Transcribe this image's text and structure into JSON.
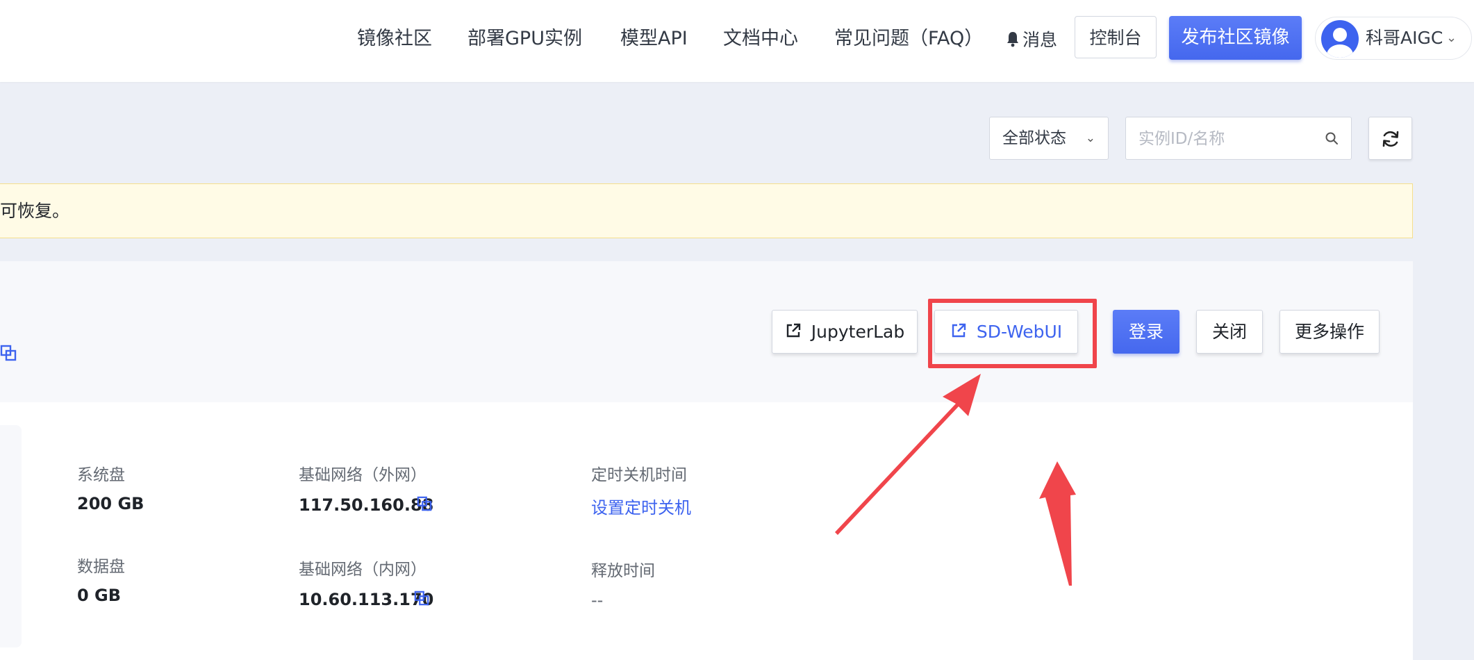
{
  "nav": {
    "links": [
      "镜像社区",
      "部署GPU实例",
      "模型API",
      "文档中心",
      "常见问题（FAQ）"
    ],
    "messages_label": "消息",
    "console_label": "控制台",
    "publish_label": "发布社区镜像",
    "user_name": "科哥AIGC"
  },
  "toolbar": {
    "status_select": "全部状态",
    "search_placeholder": "实例ID/名称"
  },
  "notice": {
    "text": "可恢复。"
  },
  "instance": {
    "actions": {
      "jupyterlab": "JupyterLab",
      "sd_webui": "SD-WebUI",
      "login": "登录",
      "close": "关闭",
      "more": "更多操作"
    },
    "details": {
      "system_disk_label": "系统盘",
      "system_disk_value": "200 GB",
      "data_disk_label": "数据盘",
      "data_disk_value": "0 GB",
      "public_net_label": "基础网络（外网）",
      "public_ip": "117.50.160.88",
      "private_net_label": "基础网络（内网）",
      "private_ip": "10.60.113.170",
      "scheduled_shutdown_label": "定时关机时间",
      "scheduled_shutdown_link": "设置定时关机",
      "release_time_label": "释放时间",
      "release_time_value": "--"
    }
  },
  "colors": {
    "primary": "#4568ee",
    "link": "#3d63ef",
    "annotation": "#f0454b",
    "notice_bg": "#fffbe6"
  }
}
